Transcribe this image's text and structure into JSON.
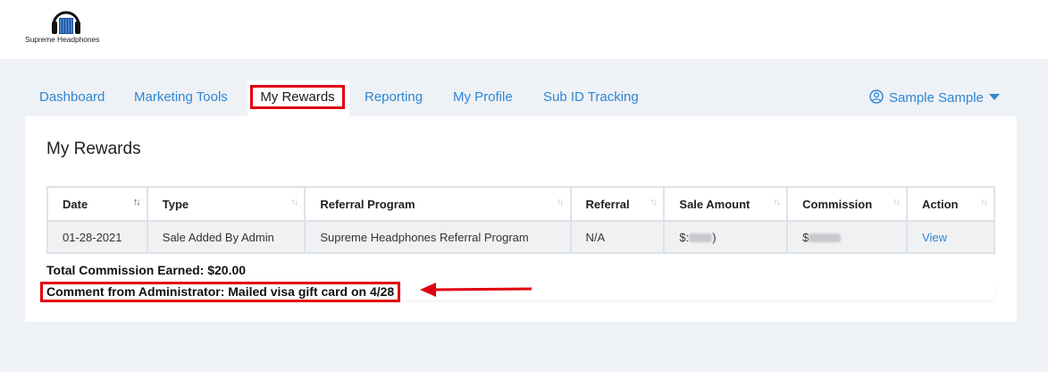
{
  "brand": {
    "name": "Supreme Headphones"
  },
  "nav": {
    "items": [
      "Dashboard",
      "Marketing Tools",
      "My Rewards",
      "Reporting",
      "My Profile",
      "Sub ID Tracking"
    ],
    "active": "My Rewards"
  },
  "user": {
    "name": "Sample Sample"
  },
  "page": {
    "title": "My Rewards"
  },
  "table": {
    "headers": [
      "Date",
      "Type",
      "Referral Program",
      "Referral",
      "Sale Amount",
      "Commission",
      "Action"
    ],
    "rows": [
      {
        "date": "01-28-2021",
        "type": "Sale Added By Admin",
        "program": "Supreme Headphones Referral Program",
        "referral": "N/A",
        "sale_amount": "$:",
        "sale_amount_suffix": ")",
        "commission": "$",
        "action": "View"
      }
    ]
  },
  "summary": {
    "total": "Total Commission Earned: $20.00",
    "comment": "Comment from Administrator: Mailed visa gift card on 4/28"
  },
  "colors": {
    "link": "#2f86d6",
    "highlight": "#e0000f",
    "background": "#eef1f5"
  }
}
